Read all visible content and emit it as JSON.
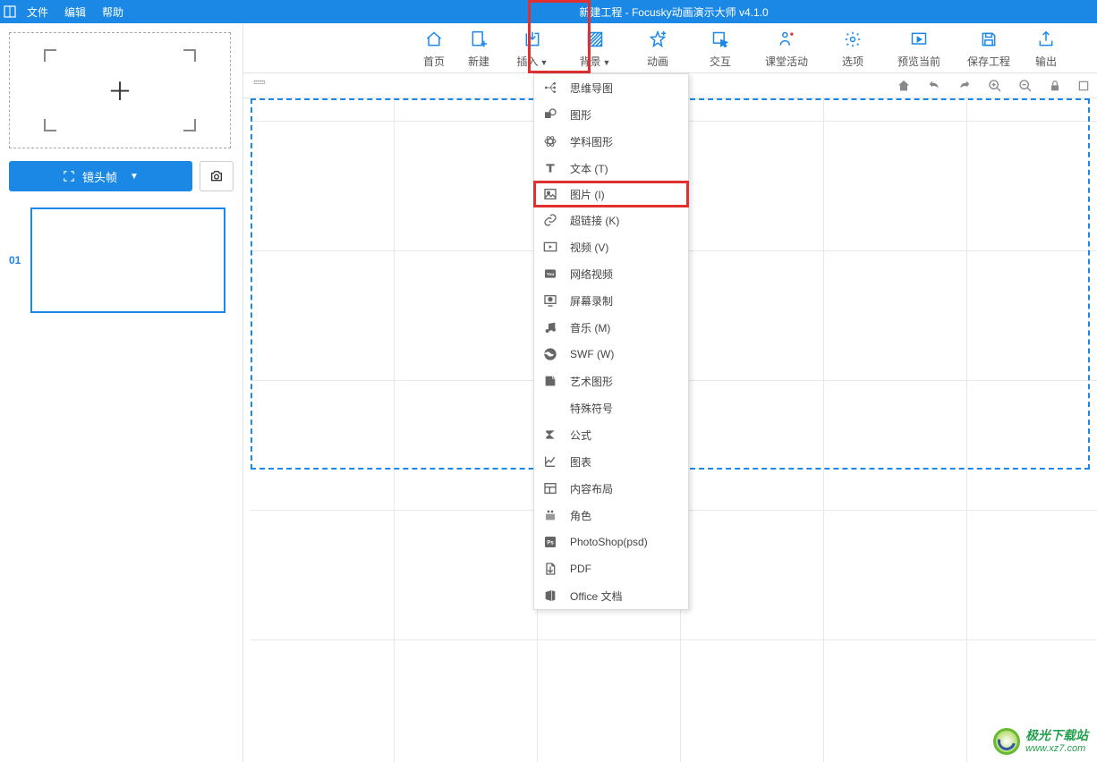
{
  "titlebar": {
    "menus": [
      "文件",
      "编辑",
      "帮助"
    ],
    "title": "新建工程 - Focusky动画演示大师  v4.1.0"
  },
  "toolbar": {
    "items": [
      {
        "label": "首页",
        "icon": "home-icon"
      },
      {
        "label": "新建",
        "icon": "new-icon"
      },
      {
        "label": "插入",
        "icon": "insert-icon",
        "dropdown": true,
        "highlighted": true
      },
      {
        "label": "背景",
        "icon": "background-icon",
        "dropdown": true
      },
      {
        "label": "动画",
        "icon": "animation-icon"
      },
      {
        "label": "交互",
        "icon": "interact-icon"
      },
      {
        "label": "课堂活动",
        "icon": "classroom-icon"
      },
      {
        "label": "选项",
        "icon": "options-icon"
      },
      {
        "label": "预览当前",
        "icon": "preview-icon"
      },
      {
        "label": "保存工程",
        "icon": "save-icon"
      },
      {
        "label": "输出",
        "icon": "export-icon"
      }
    ]
  },
  "sidebar": {
    "frame_button": "镜头帧",
    "slide_number": "01"
  },
  "dropdown": {
    "items": [
      {
        "label": "思维导图",
        "icon": "mindmap-icon"
      },
      {
        "label": "图形",
        "icon": "shape-icon"
      },
      {
        "label": "学科图形",
        "icon": "subject-shape-icon"
      },
      {
        "label": "文本 (T)",
        "icon": "text-icon"
      },
      {
        "label": "图片 (I)",
        "icon": "image-icon",
        "highlighted": true
      },
      {
        "label": "超链接 (K)",
        "icon": "link-icon"
      },
      {
        "label": "视频 (V)",
        "icon": "video-icon"
      },
      {
        "label": "网络视频",
        "icon": "webvideo-icon"
      },
      {
        "label": "屏幕录制",
        "icon": "screenrec-icon"
      },
      {
        "label": "音乐 (M)",
        "icon": "music-icon"
      },
      {
        "label": "SWF (W)",
        "icon": "swf-icon"
      },
      {
        "label": "艺术图形",
        "icon": "artshape-icon"
      },
      {
        "label": "特殊符号",
        "icon": "symbol-icon"
      },
      {
        "label": "公式",
        "icon": "formula-icon"
      },
      {
        "label": "图表",
        "icon": "chart-icon"
      },
      {
        "label": "内容布局",
        "icon": "layout-icon"
      },
      {
        "label": "角色",
        "icon": "character-icon"
      },
      {
        "label": "PhotoShop(psd)",
        "icon": "psd-icon"
      },
      {
        "label": "PDF",
        "icon": "pdf-icon"
      },
      {
        "label": "Office 文档",
        "icon": "office-icon"
      }
    ]
  },
  "watermark": {
    "line1": "极光下载站",
    "line2": "www.xz7.com"
  }
}
